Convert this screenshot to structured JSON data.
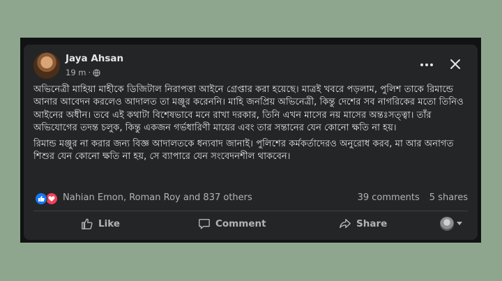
{
  "post": {
    "author": "Jaya Ahsan",
    "time": "19 m",
    "audience_icon": "globe-icon",
    "paragraphs": [
      "অভিনেত্রী মাহিয়া মাহীকে ডিজিটাল নিরাপত্তা আইনে গ্রেপ্তার করা হয়েছে। মাত্রই খবরে পড়লাম, পুলিশ তাকে রিমান্ডে আনার আবেদন করলেও আদালত তা মঞ্জুর করেননি। মাহি জনপ্রিয় অভিনেত্রী, কিন্তু দেশের সব নাগরিকের মতো তিনিও আইনের অধীন। তবে এই কথাটা বিশেষভাবে মনে রাখা দরকার, তিনি এখন মাসের নয় মাসের অন্তঃসত্ত্বা। তাঁর অভিযোগের তদন্ত চলুক, কিন্তু একজন গর্ভধারিণী মায়ের এবং তার সন্তানের যেন কোনো ক্ষতি না হয়।",
      "রিমান্ড মঞ্জুর না করার জন্য বিজ্ঞ আদালতকে ধন্যবাদ জানাই। পুলিশের কর্মকর্তাদেরও অনুরোধ করব, মা আর অনাগত শিশুর যেন কোনো ক্ষতি না হয়, সে ব্যাপারে যেন সংবেদনশীল থাকবেন।"
    ]
  },
  "reactions": {
    "icons": [
      "like-icon",
      "love-icon"
    ],
    "names": "Nahian Emon, Roman Roy and 837 others",
    "comments": "39 comments",
    "shares": "5 shares"
  },
  "actions": {
    "like": "Like",
    "comment": "Comment",
    "share": "Share"
  },
  "colors": {
    "page_bg": "#8fa68e",
    "card_bg": "#242526",
    "text_primary": "#e4e6eb",
    "text_secondary": "#b0b3b8",
    "like_blue": "#1877f2",
    "love_red": "#f33e58"
  }
}
